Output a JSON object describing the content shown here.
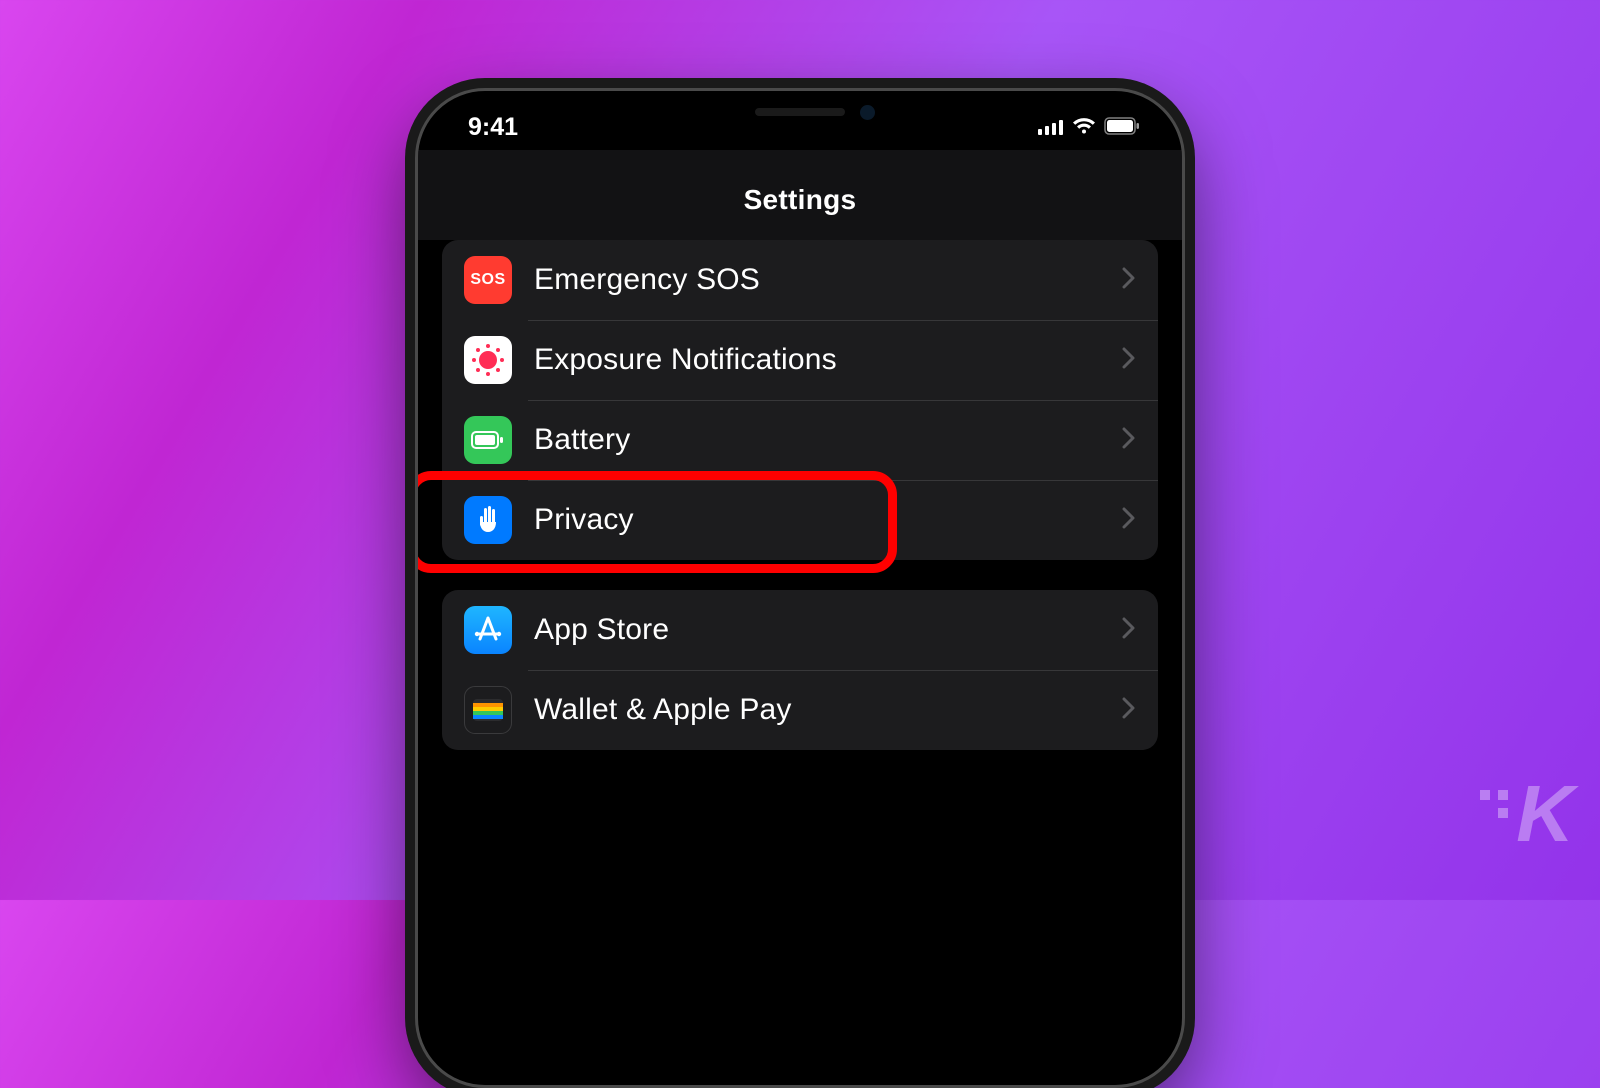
{
  "statusbar": {
    "time": "9:41"
  },
  "header": {
    "title": "Settings"
  },
  "group1": {
    "items": [
      {
        "label": "Emergency SOS",
        "icon": "sos-icon",
        "bg": "#ff3b30",
        "content": "SOS"
      },
      {
        "label": "Exposure Notifications",
        "icon": "exposure-icon",
        "bg": "#ffffff"
      },
      {
        "label": "Battery",
        "icon": "battery-icon",
        "bg": "#34c759"
      },
      {
        "label": "Privacy",
        "icon": "privacy-icon",
        "bg": "#007aff",
        "highlighted": true
      }
    ]
  },
  "group2": {
    "items": [
      {
        "label": "App Store",
        "icon": "appstore-icon",
        "bg": "#0a84ff"
      },
      {
        "label": "Wallet & Apple Pay",
        "icon": "wallet-icon",
        "bg": "#1c1c1e"
      }
    ]
  },
  "watermark": "K"
}
